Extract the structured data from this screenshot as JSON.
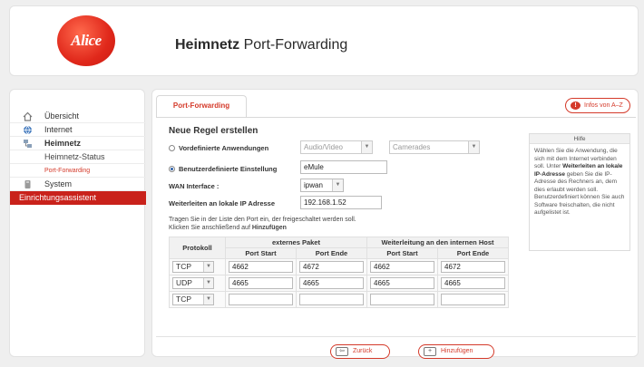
{
  "header": {
    "logo_text": "Alice",
    "title_bold": "Heimnetz",
    "title_rest": " Port-Forwarding"
  },
  "sidebar": {
    "items": [
      {
        "label": "Übersicht"
      },
      {
        "label": "Internet"
      },
      {
        "label": "Heimnetz"
      },
      {
        "label": "Heimnetz-Status"
      },
      {
        "label": "Port-Forwarding"
      },
      {
        "label": "System"
      },
      {
        "label": "Einrichtungsassistent"
      }
    ]
  },
  "main": {
    "tab_label": "Port-Forwarding",
    "info_button": "Infos von A–Z",
    "section_title": "Neue Regel erstellen",
    "predefined_label": "Vordefinierte Anwendungen",
    "predefined_category": "Audio/Video",
    "predefined_app": "Camerades",
    "custom_label": "Benutzerdefinierte Einstellung",
    "custom_value": "eMule",
    "wan_label": "WAN Interface :",
    "wan_value": "ipwan",
    "forward_label": "Weiterleiten an lokale IP Adresse",
    "forward_value": "192.168.1.52",
    "help_line1": "Tragen Sie in der Liste den Port ein, der freigeschaltet werden soll.",
    "help_line2_prefix": "Klicken Sie anschließend auf ",
    "help_line2_link": "Hinzufügen"
  },
  "table": {
    "col_protocol": "Protokoll",
    "group_external": "externes Paket",
    "group_internal": "Weiterleitung an den internen Host",
    "port_start": "Port Start",
    "port_end": "Port Ende",
    "rows": [
      {
        "protocol": "TCP",
        "ext_start": "4662",
        "ext_end": "4672",
        "int_start": "4662",
        "int_end": "4672"
      },
      {
        "protocol": "UDP",
        "ext_start": "4665",
        "ext_end": "4665",
        "int_start": "4665",
        "int_end": "4665"
      },
      {
        "protocol": "TCP",
        "ext_start": "",
        "ext_end": "",
        "int_start": "",
        "int_end": ""
      }
    ]
  },
  "hint": {
    "title": "Hilfe",
    "p1": "Wählen Sie die Anwendung, die sich mit dem Internet verbinden soll. Unter ",
    "p1_bold": "Weiterleiten an lokale IP-Adresse",
    "p2": " geben Sie die IP-Adresse des Rechners an, dem dies erlaubt werden soll. Benutzerdefiniert können Sie auch Software freischalten, die nicht aufgelistet ist."
  },
  "footer": {
    "back": "Zurück",
    "add": "Hinzufügen"
  }
}
